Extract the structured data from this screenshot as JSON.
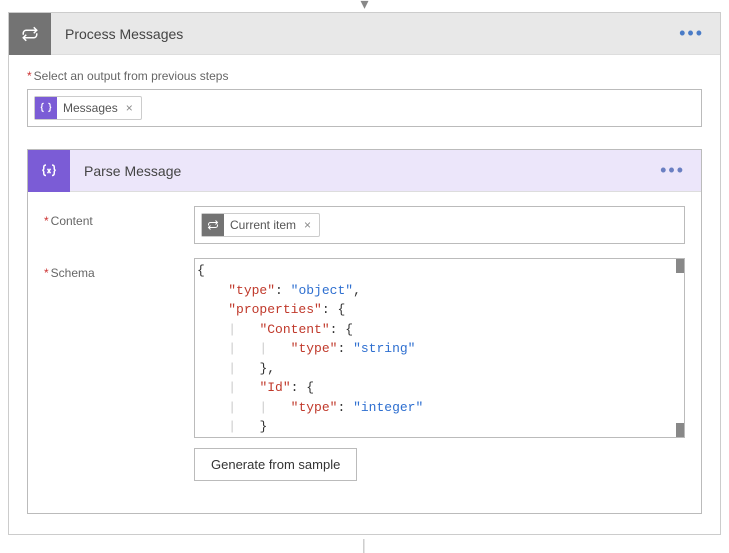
{
  "outer_action": {
    "title": "Process Messages",
    "field_label": "Select an output from previous steps",
    "token": {
      "label": "Messages"
    }
  },
  "inner_action": {
    "title": "Parse Message",
    "content_label": "Content",
    "content_token": {
      "label": "Current item"
    },
    "schema_label": "Schema",
    "generate_button": "Generate from sample",
    "schema_text": {
      "l1": "{",
      "l2_key": "\"type\"",
      "l2_val": "\"object\"",
      "l3_key": "\"properties\"",
      "l4_key": "\"Content\"",
      "l5_key": "\"type\"",
      "l5_val": "\"string\"",
      "l7_key": "\"Id\"",
      "l8_key": "\"type\"",
      "l8_val": "\"integer\""
    }
  }
}
